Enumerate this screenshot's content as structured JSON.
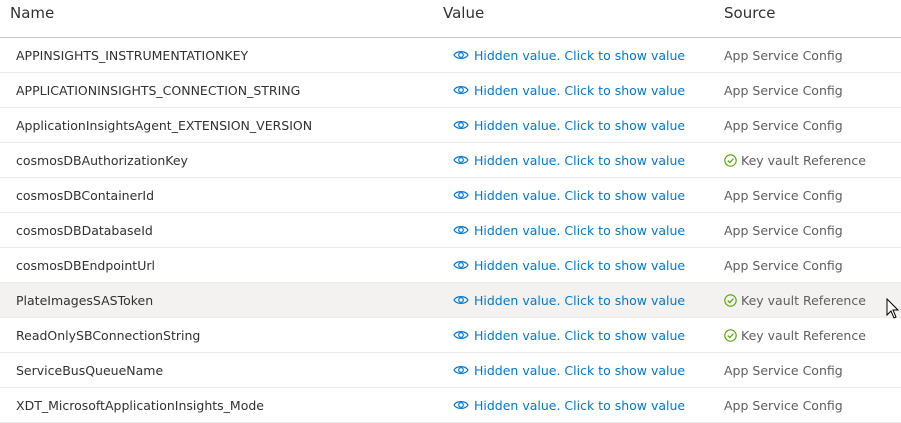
{
  "columns": {
    "name": "Name",
    "value": "Value",
    "source": "Source"
  },
  "colors": {
    "link": "#0078d4",
    "success": "#57a300",
    "text": "#323130",
    "muted": "#605e5c"
  },
  "icons": {
    "value": "eye-icon",
    "keyvault": "check-circle-icon"
  },
  "rows": [
    {
      "name": "APPINSIGHTS_INSTRUMENTATIONKEY",
      "value": "Hidden value. Click to show value",
      "source": "App Service Config",
      "keyvault": false
    },
    {
      "name": "APPLICATIONINSIGHTS_CONNECTION_STRING",
      "value": "Hidden value. Click to show value",
      "source": "App Service Config",
      "keyvault": false
    },
    {
      "name": "ApplicationInsightsAgent_EXTENSION_VERSION",
      "value": "Hidden value. Click to show value",
      "source": "App Service Config",
      "keyvault": false
    },
    {
      "name": "cosmosDBAuthorizationKey",
      "value": "Hidden value. Click to show value",
      "source": "Key vault Reference",
      "keyvault": true
    },
    {
      "name": "cosmosDBContainerId",
      "value": "Hidden value. Click to show value",
      "source": "App Service Config",
      "keyvault": false
    },
    {
      "name": "cosmosDBDatabaseId",
      "value": "Hidden value. Click to show value",
      "source": "App Service Config",
      "keyvault": false
    },
    {
      "name": "cosmosDBEndpointUrl",
      "value": "Hidden value. Click to show value",
      "source": "App Service Config",
      "keyvault": false
    },
    {
      "name": "PlateImagesSASToken",
      "value": "Hidden value. Click to show value",
      "source": "Key vault Reference",
      "keyvault": true,
      "hovered": true
    },
    {
      "name": "ReadOnlySBConnectionString",
      "value": "Hidden value. Click to show value",
      "source": "Key vault Reference",
      "keyvault": true
    },
    {
      "name": "ServiceBusQueueName",
      "value": "Hidden value. Click to show value",
      "source": "App Service Config",
      "keyvault": false
    },
    {
      "name": "XDT_MicrosoftApplicationInsights_Mode",
      "value": "Hidden value. Click to show value",
      "source": "App Service Config",
      "keyvault": false
    }
  ]
}
